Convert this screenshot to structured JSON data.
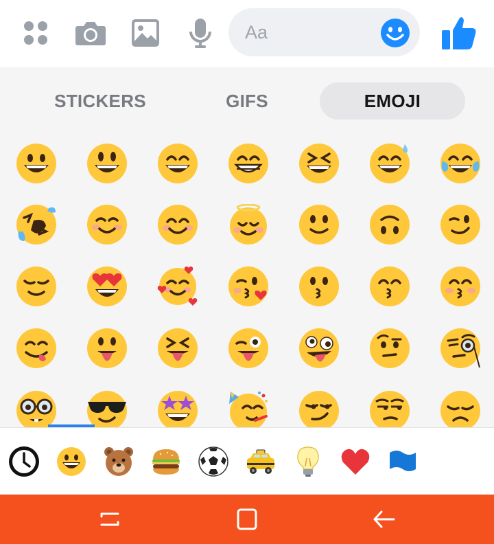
{
  "composer": {
    "placeholder": "Aa",
    "icons": [
      "menu-dots-icon",
      "camera-icon",
      "gallery-icon",
      "microphone-icon",
      "emoji-icon",
      "like-thumb-icon"
    ],
    "accent_color": "#1a8cff"
  },
  "tabs": [
    {
      "label": "STICKERS",
      "selected": false
    },
    {
      "label": "GIFS",
      "selected": false
    },
    {
      "label": "EMOJI",
      "selected": true
    }
  ],
  "emoji_grid": {
    "rows": [
      [
        "grinning-face",
        "grinning-face-big-eyes",
        "grinning-smiling-eyes",
        "beaming-face",
        "grinning-squinting-face",
        "grinning-sweat",
        "tears-of-joy"
      ],
      [
        "rolling-on-floor-laughing",
        "smiling-face",
        "smiling-eyes",
        "smiling-halo",
        "slightly-smiling-face",
        "upside-down-face",
        "winking-face"
      ],
      [
        "relieved-face",
        "heart-eyes",
        "smiling-hearts",
        "face-blowing-kiss",
        "kissing-face",
        "kissing-smiling-eyes",
        "kissing-closed-eyes"
      ],
      [
        "face-savoring-food",
        "face-with-tongue",
        "squinting-tongue",
        "winking-tongue",
        "zany-face",
        "raised-eyebrow",
        "face-with-monocle"
      ],
      [
        "nerd-face",
        "smiling-sunglasses",
        "star-struck",
        "partying-face",
        "smirking-face",
        "unamused-face",
        "disappointed-face"
      ]
    ]
  },
  "categories": [
    {
      "name": "recent-clock-icon",
      "selected": false
    },
    {
      "name": "smileys-icon",
      "selected": true
    },
    {
      "name": "bear-animals-icon",
      "selected": false
    },
    {
      "name": "burger-food-icon",
      "selected": false
    },
    {
      "name": "soccer-ball-icon",
      "selected": false
    },
    {
      "name": "taxi-travel-icon",
      "selected": false
    },
    {
      "name": "light-bulb-objects-icon",
      "selected": false
    },
    {
      "name": "heart-symbols-icon",
      "selected": false
    },
    {
      "name": "flag-icon",
      "selected": false
    }
  ],
  "system_nav": {
    "buttons": [
      "recents-icon",
      "home-icon",
      "back-icon"
    ],
    "color": "#f4511e"
  }
}
